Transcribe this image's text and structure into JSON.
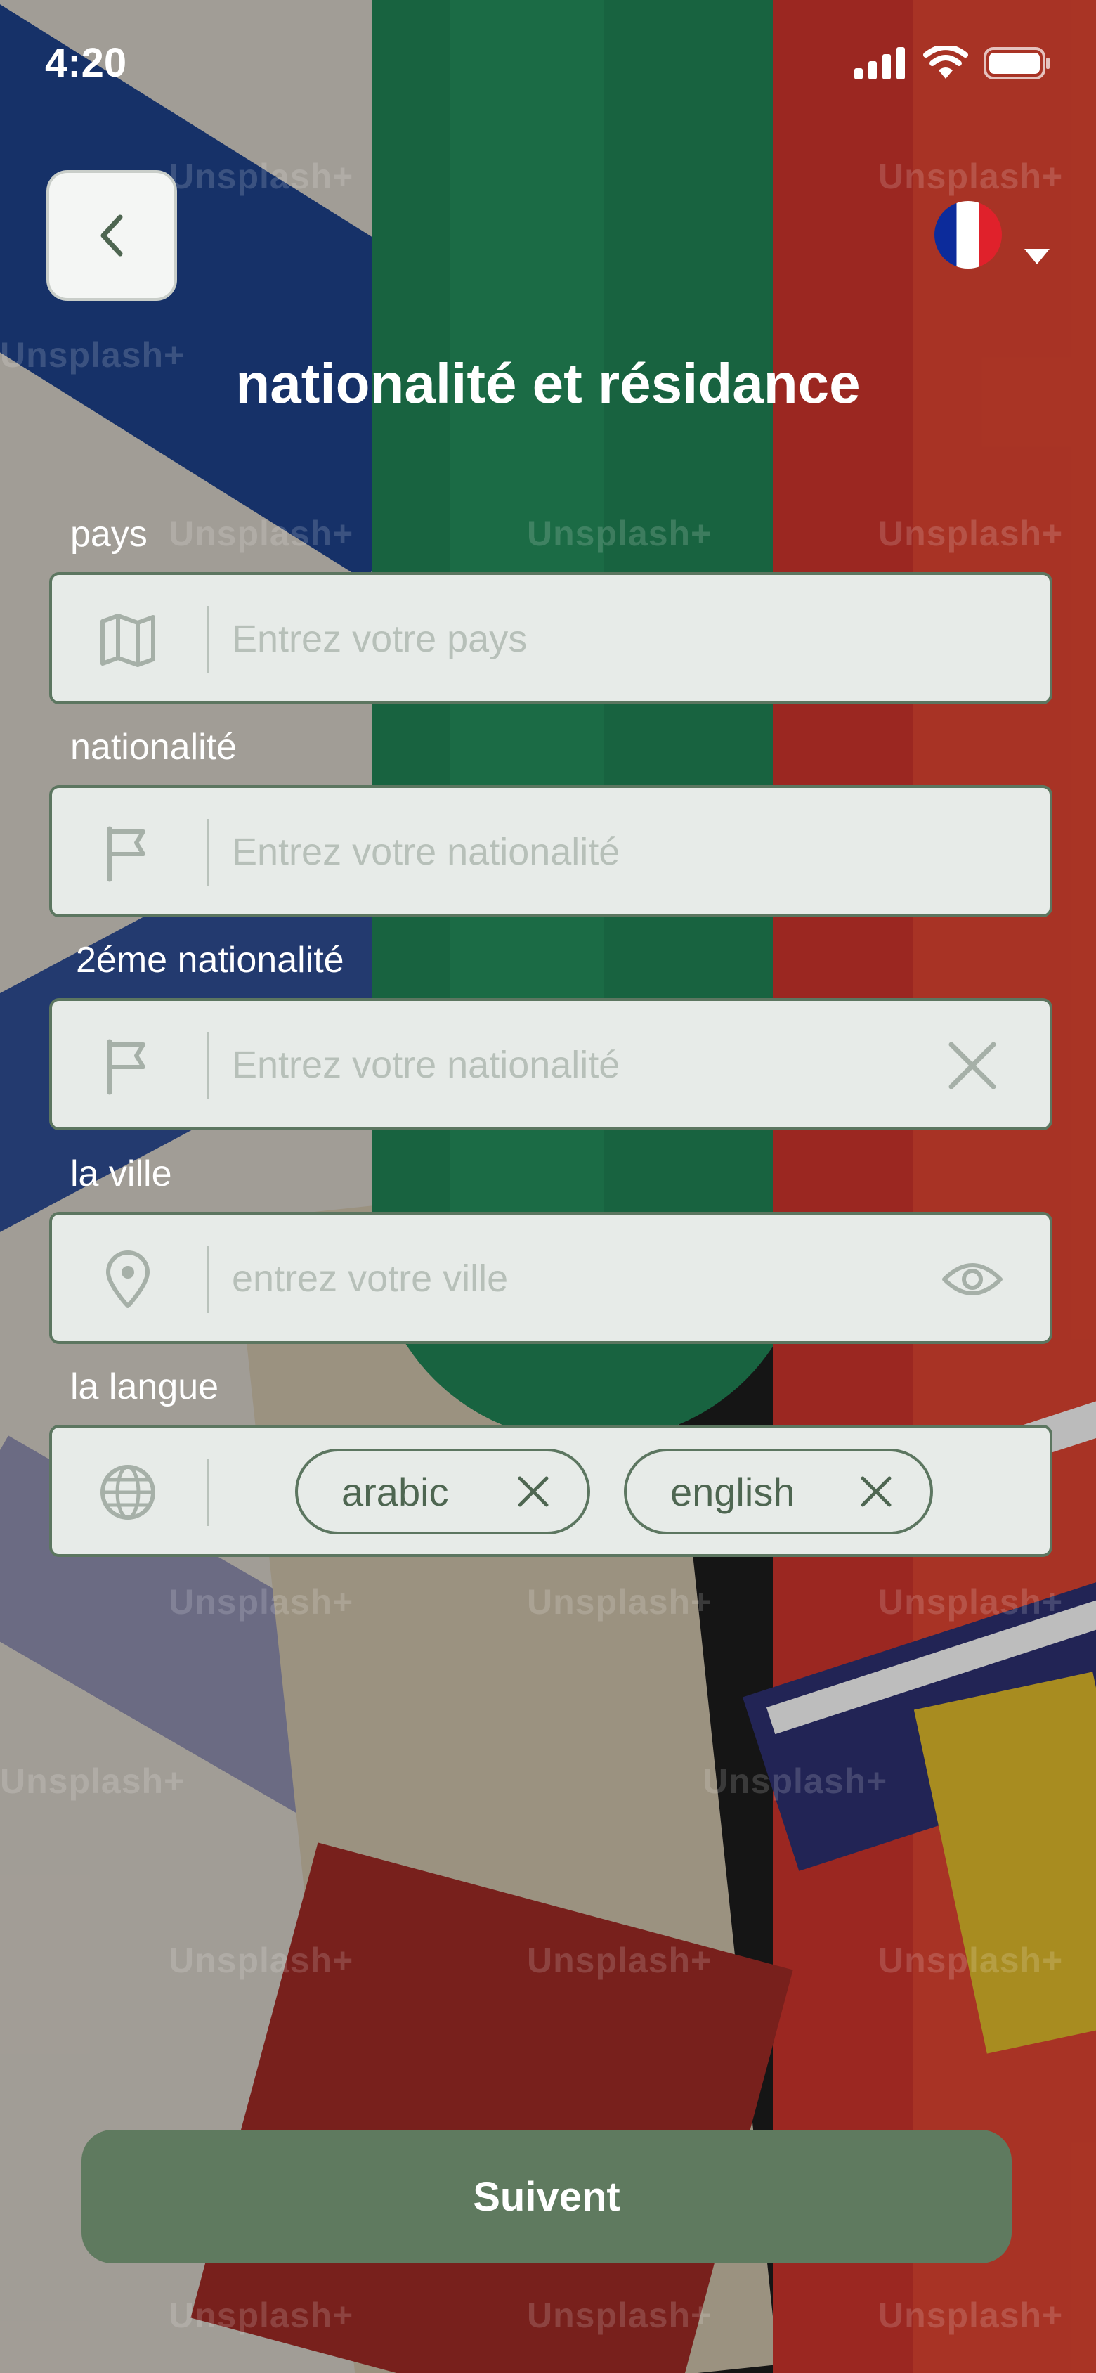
{
  "status_bar": {
    "time": "4:20"
  },
  "header": {
    "title": "nationalité et résidance",
    "language_flag": "france-flag-icon"
  },
  "form": {
    "country": {
      "label": "pays",
      "placeholder": "Entrez votre pays",
      "icon": "map-icon"
    },
    "nationality": {
      "label": "nationalité",
      "placeholder": "Entrez votre nationalité",
      "icon": "flag-icon"
    },
    "second_nationality": {
      "label": "2éme nationalité",
      "placeholder": "Entrez votre nationalité",
      "icon": "flag-icon",
      "trailing_icon": "close-icon"
    },
    "city": {
      "label": "la ville",
      "placeholder": "entrez votre ville",
      "icon": "location-pin-icon",
      "trailing_icon": "eye-icon"
    },
    "language": {
      "label": "la langue",
      "icon": "globe-icon",
      "chips": [
        {
          "label": "arabic"
        },
        {
          "label": "english"
        }
      ]
    }
  },
  "actions": {
    "next_label": "Suivent"
  },
  "background": {
    "watermark": "Unsplash+"
  },
  "colors": {
    "accent": "#5f7a5f",
    "field_bg": "#e7ebe8",
    "field_border": "#5c7660",
    "chip_text": "#4e6651"
  }
}
